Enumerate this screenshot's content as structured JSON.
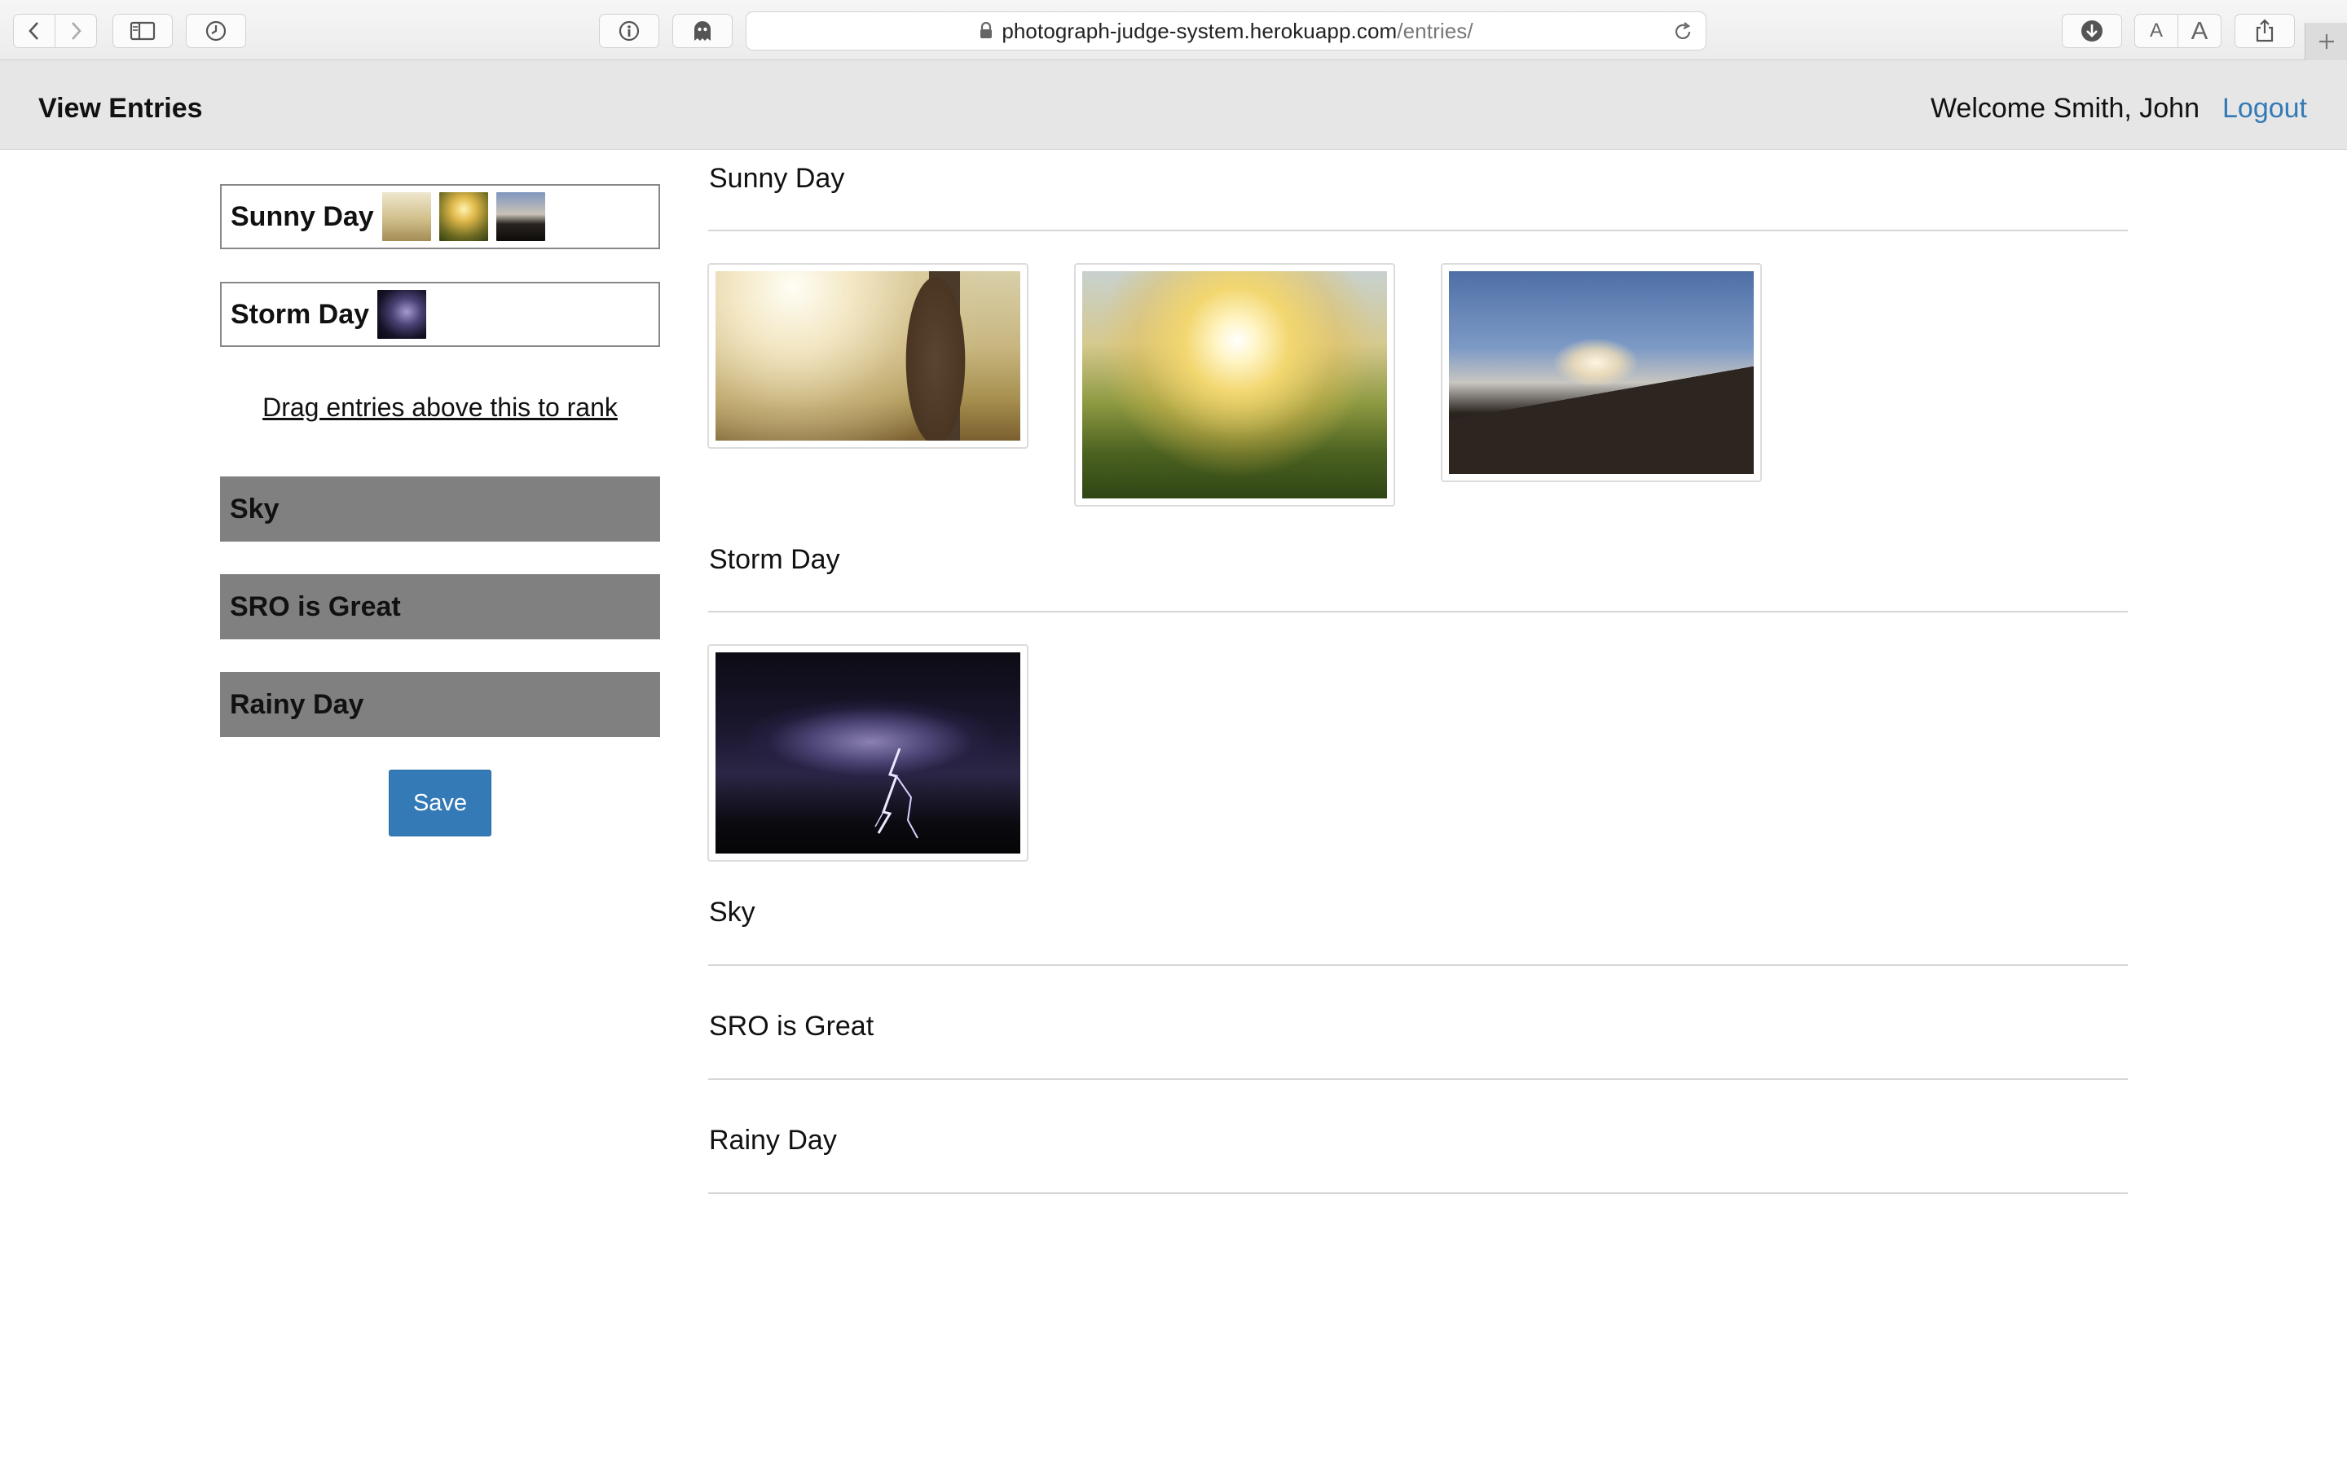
{
  "browser": {
    "url_host": "photograph-judge-system.herokuapp.com",
    "url_path": "/entries/",
    "font_small_label": "A",
    "font_large_label": "A"
  },
  "navbar": {
    "brand": "View Entries",
    "welcome": "Welcome Smith, John",
    "logout": "Logout"
  },
  "ranking": {
    "ranked": [
      {
        "label": "Sunny Day",
        "thumbs": [
          "field",
          "grass",
          "bench"
        ]
      },
      {
        "label": "Storm Day",
        "thumbs": [
          "storm"
        ]
      }
    ],
    "divider_text": "Drag entries above this to rank",
    "unranked": [
      {
        "label": "Sky"
      },
      {
        "label": "SRO is Great"
      },
      {
        "label": "Rainy Day"
      }
    ],
    "save_label": "Save"
  },
  "entries": [
    {
      "title": "Sunny Day",
      "photos": [
        "field",
        "grass",
        "bench"
      ]
    },
    {
      "title": "Storm Day",
      "photos": [
        "storm"
      ]
    },
    {
      "title": "Sky",
      "photos": []
    },
    {
      "title": "SRO is Great",
      "photos": []
    },
    {
      "title": "Rainy Day",
      "photos": []
    }
  ],
  "colors": {
    "primary": "#337ab7",
    "navbar_bg": "#e6e6e6",
    "unranked_bg": "#808080"
  }
}
